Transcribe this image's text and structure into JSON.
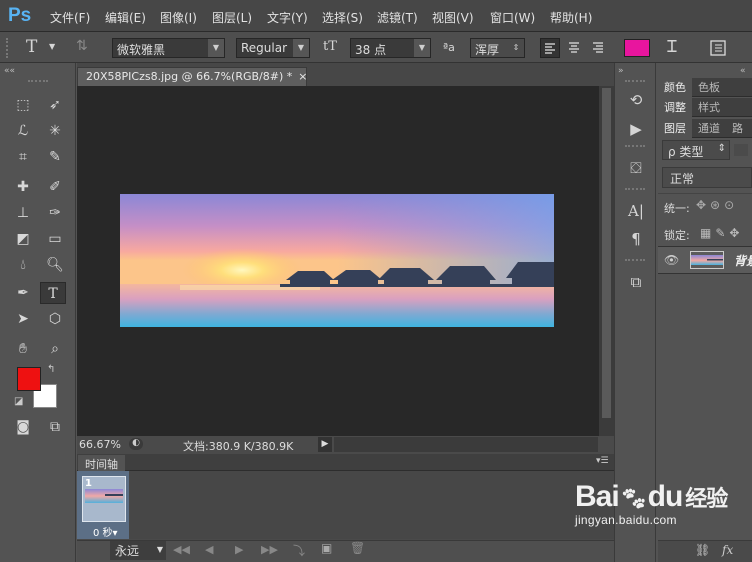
{
  "app": {
    "logo": "Ps"
  },
  "menu": [
    "文件(F)",
    "编辑(E)",
    "图像(I)",
    "图层(L)",
    "文字(Y)",
    "选择(S)",
    "滤镜(T)",
    "视图(V)",
    "窗口(W)",
    "帮助(H)"
  ],
  "options": {
    "tool_icon": "T",
    "font_family": "微软雅黑",
    "font_style": "Regular",
    "size_icon": "tT",
    "font_size": "38 点",
    "aa_icon": "ªa",
    "anti_alias": "浑厚",
    "text_color": "#e8159e"
  },
  "document": {
    "tab_title": "20X58PICzs8.jpg @ 66.7%(RGB/8#) *",
    "close": "×"
  },
  "status": {
    "zoom": "66.67%",
    "doc_info": "文档:380.9 K/380.9K"
  },
  "timeline": {
    "title": "时间轴",
    "frame_number": "1",
    "frame_time": "0 秒▾",
    "loop": "永远"
  },
  "panels": {
    "row1": [
      "颜色",
      "色板"
    ],
    "row2": [
      "调整",
      "样式"
    ],
    "row3": [
      "图层",
      "通道",
      "路"
    ],
    "kind": "ρ 类型",
    "blend": "正常",
    "unify_label": "统一:",
    "lock_label": "锁定:",
    "layer_name": "背景"
  },
  "colors": {
    "foreground": "#ee1111",
    "background": "#ffffff",
    "accent": "#58b3f3"
  },
  "watermark": {
    "brand_a": "Bai",
    "brand_b": "du",
    "brand_cn": "经验",
    "url": "jingyan.baidu.com"
  }
}
